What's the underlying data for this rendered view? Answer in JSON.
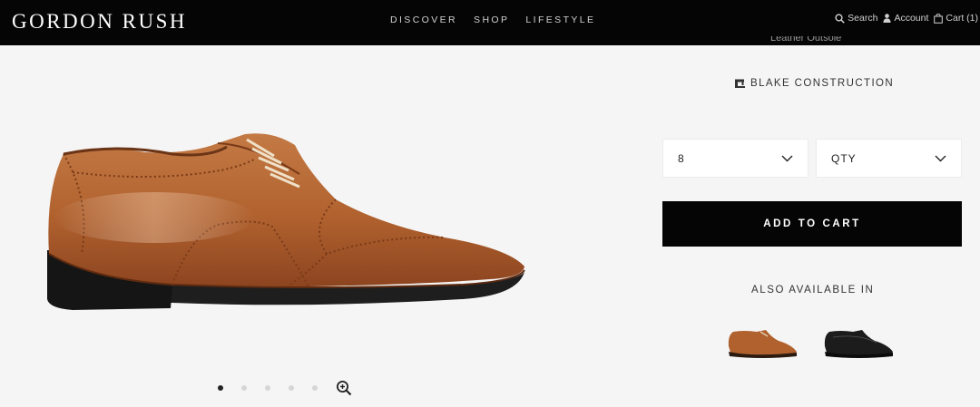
{
  "header": {
    "logo": "GORDON RUSH",
    "nav": [
      "DISCOVER",
      "SHOP",
      "LIFESTYLE"
    ],
    "search_label": "Search",
    "account_label": "Account",
    "cart_label": "Cart (1)"
  },
  "product": {
    "cut_off_text": "Leather Outsole",
    "construction_label": "BLAKE CONSTRUCTION",
    "size_value": "8",
    "qty_label": "QTY",
    "add_to_cart_label": "ADD TO CART",
    "also_available_label": "ALSO AVAILABLE IN",
    "variants": [
      {
        "color_name": "tan",
        "color": "#b0612e"
      },
      {
        "color_name": "black",
        "color": "#1c1c1c"
      }
    ]
  },
  "carousel": {
    "count": 5,
    "active_index": 0
  },
  "colors": {
    "header_bg": "#050505",
    "page_bg": "#f5f5f5",
    "button_bg": "#050505",
    "shoe_leather": "#b0612e",
    "shoe_sole": "#1e1e1e"
  }
}
